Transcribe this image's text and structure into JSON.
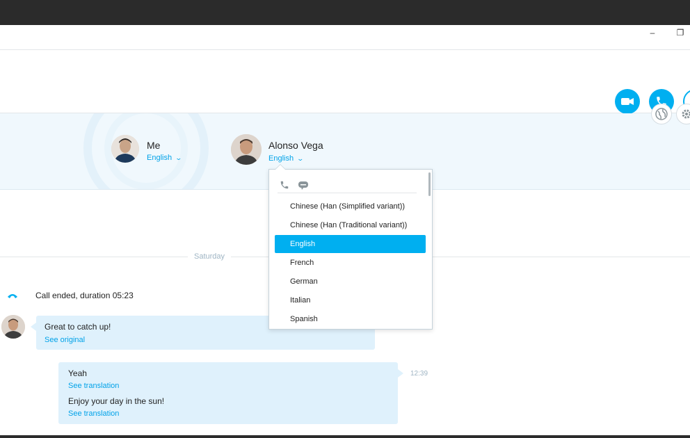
{
  "window": {
    "minimize_label": "–",
    "restore_label": "❐"
  },
  "header": {
    "video_call_icon": "video-camera-icon",
    "audio_call_icon": "phone-icon",
    "add_icon": "plus-icon"
  },
  "translator": {
    "globe_icon": "globe-icon",
    "settings_icon": "gear-icon",
    "participants": [
      {
        "name": "Me",
        "language": "English"
      },
      {
        "name": "Alonso Vega",
        "language": "English"
      }
    ]
  },
  "language_dropdown": {
    "mode_icons": [
      "phone-icon",
      "chat-bubble-icon"
    ],
    "options": [
      "Chinese (Han (Simplified variant))",
      "Chinese (Han (Traditional variant))",
      "English",
      "French",
      "German",
      "Italian",
      "Spanish"
    ],
    "selected": "English"
  },
  "conversation": {
    "day_label": "Saturday",
    "call_ended_text": "Call ended, duration 05:23",
    "messages": [
      {
        "text": "Great to catch up!",
        "link": "See original"
      },
      {
        "time": "12:39",
        "lines": [
          {
            "text": "Yeah",
            "link": "See translation"
          },
          {
            "text": "Enjoy your day in the sun!",
            "link": "See translation"
          }
        ]
      }
    ]
  },
  "colors": {
    "accent": "#00aff0",
    "link": "#00a2e8",
    "bubble": "#dff1fc",
    "translator_bg": "#f0f8fd"
  }
}
